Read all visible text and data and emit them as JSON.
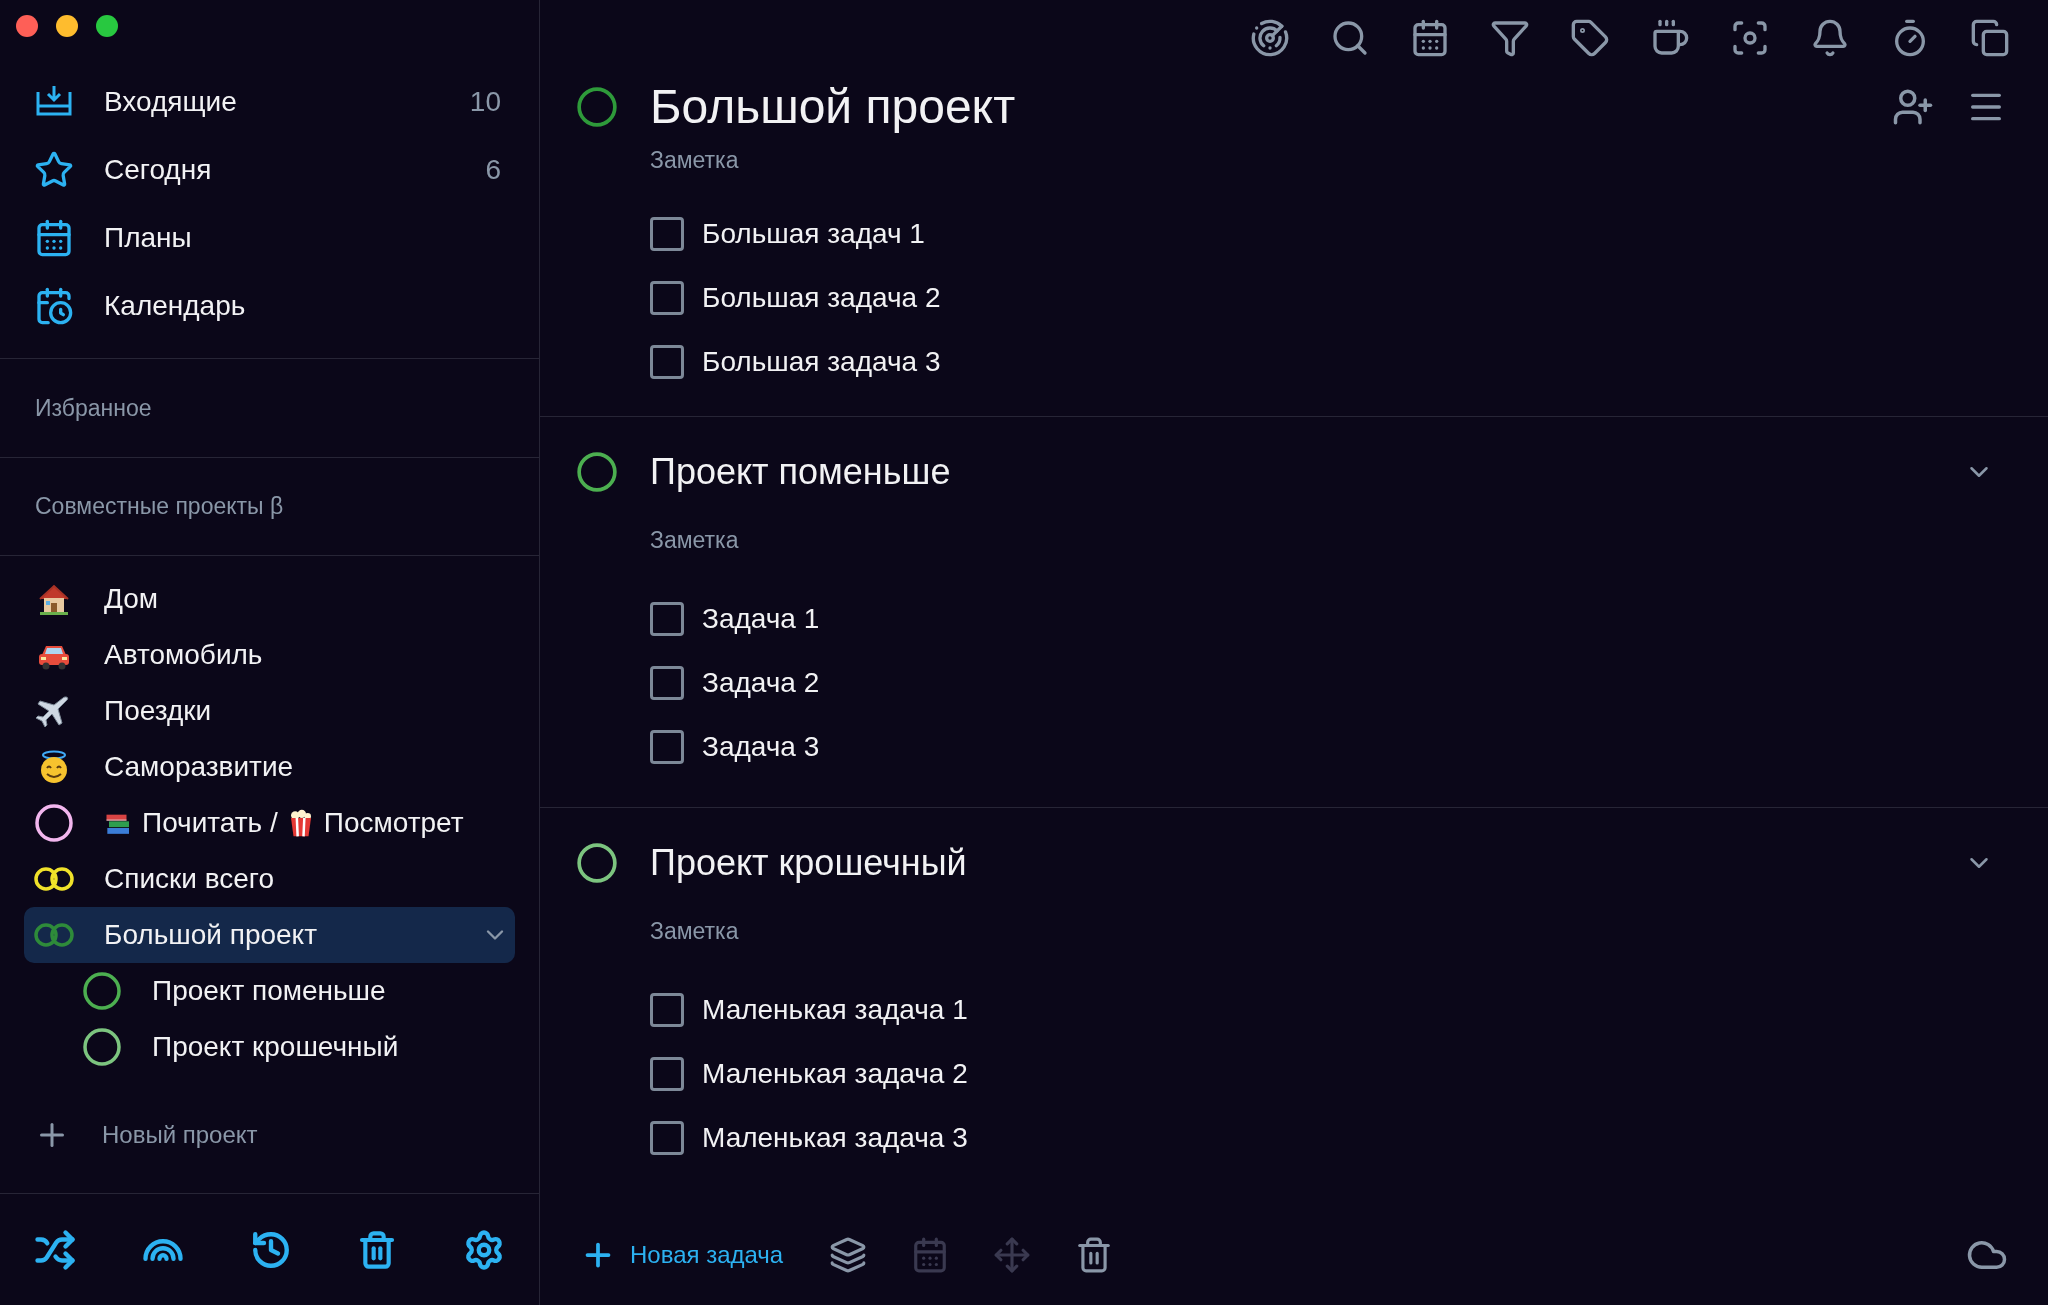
{
  "window_controls": [
    {
      "color": "#fe5f57"
    },
    {
      "color": "#febc2e"
    },
    {
      "color": "#28c840"
    }
  ],
  "sidebar": {
    "views": [
      {
        "kind": "inbox",
        "label": "Входящие",
        "count": "10"
      },
      {
        "kind": "today",
        "label": "Сегодня",
        "count": "6"
      },
      {
        "kind": "plans",
        "label": "Планы"
      },
      {
        "kind": "calendar",
        "label": "Календарь"
      }
    ],
    "favorites_header": "Избранное",
    "shared_header": "Совместные проекты β",
    "projects": [
      {
        "kind": "house",
        "label": "Дом",
        "selected": false
      },
      {
        "kind": "car",
        "label": "Автомобиль",
        "selected": false
      },
      {
        "kind": "plane",
        "label": "Поездки",
        "selected": false
      },
      {
        "kind": "smiley",
        "label": "Саморазвитие",
        "selected": false
      },
      {
        "kind": "ring",
        "color": "#f2b6ee",
        "segments": [
          {
            "kind": "books"
          },
          {
            "kind": "text",
            "text": "Почитать /"
          },
          {
            "kind": "popcorn"
          },
          {
            "kind": "text",
            "text": "Посмотрет"
          }
        ],
        "selected": false
      },
      {
        "kind": "double-ring",
        "color": "#f0e12a",
        "label": "Списки всего",
        "selected": false
      },
      {
        "kind": "double-ring",
        "color": "#2e8b3a",
        "label": "Большой проект",
        "selected": true,
        "expanded": true,
        "children": [
          {
            "kind": "ring",
            "color": "#4caf50",
            "label": "Проект поменьше",
            "selected": false
          },
          {
            "kind": "ring",
            "color": "#7cc47f",
            "label": "Проект крошечный",
            "selected": false
          }
        ]
      }
    ],
    "new_project": "Новый проект"
  },
  "main": {
    "title": "Большой проект",
    "color": "#2e9a3a",
    "note": "Заметка",
    "tasks": [
      {
        "title": "Большая задач 1",
        "checked": false
      },
      {
        "title": "Большая задача 2",
        "checked": false
      },
      {
        "title": "Большая задача 3",
        "checked": false
      }
    ],
    "sections": [
      {
        "title": "Проект поменьше",
        "color": "#4caf50",
        "note": "Заметка",
        "expanded": true,
        "tasks": [
          {
            "title": "Задача 1",
            "checked": false
          },
          {
            "title": "Задача 2",
            "checked": false
          },
          {
            "title": "Задача 3",
            "checked": false
          }
        ]
      },
      {
        "title": "Проект крошечный",
        "color": "#7cc47f",
        "note": "Заметка",
        "expanded": true,
        "tasks": [
          {
            "title": "Маленькая задача 1",
            "checked": false
          },
          {
            "title": "Маленькая задача 2",
            "checked": false
          },
          {
            "title": "Маленькая задача 3",
            "checked": false
          }
        ]
      }
    ]
  },
  "bottom_bar": {
    "new_task": "Новая задача",
    "tools": [
      {
        "kind": "layers",
        "disabled": false
      },
      {
        "kind": "calendar",
        "disabled": true
      },
      {
        "kind": "move",
        "disabled": true
      },
      {
        "kind": "trash",
        "disabled": false
      }
    ]
  }
}
